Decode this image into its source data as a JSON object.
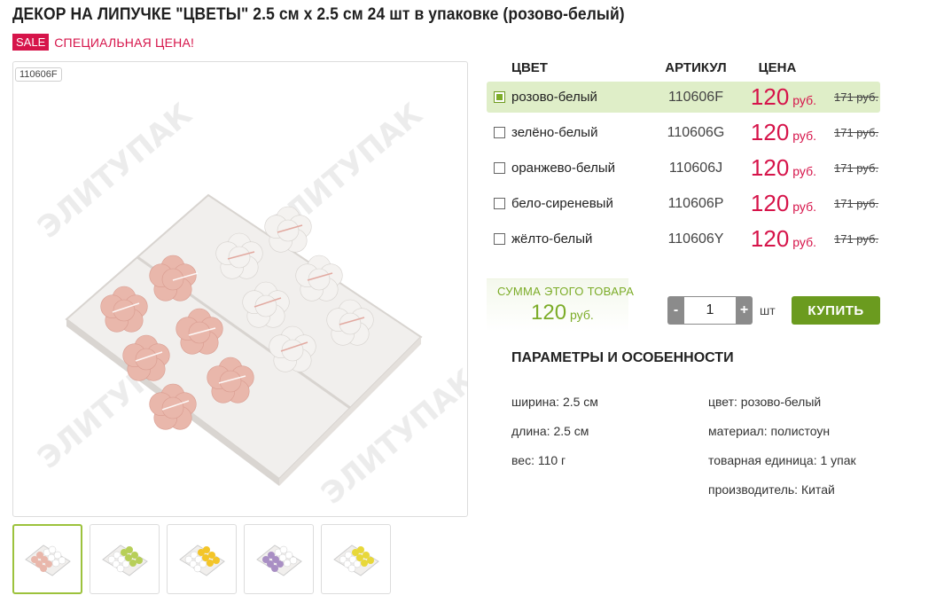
{
  "product": {
    "title": "ДЕКОР НА ЛИПУЧКЕ \"ЦВЕТЫ\" 2.5 см х 2.5 см 24 шт в упаковке (розово-белый)",
    "sale_badge": "SALE",
    "sale_text": "СПЕЦИАЛЬНАЯ ЦЕНА!",
    "image_sku_tag": "110606F",
    "watermark": "ЭЛИТУПАК"
  },
  "thumbnails": [
    {
      "name": "розово-белый",
      "colors": [
        "#e9b7ab",
        "#f2f0ee"
      ]
    },
    {
      "name": "зелёно-белый",
      "colors": [
        "#b7cf58",
        "#f2f0ee"
      ]
    },
    {
      "name": "оранжево-белый",
      "colors": [
        "#f3c528",
        "#f2f0ee"
      ]
    },
    {
      "name": "бело-сиреневый",
      "colors": [
        "#a98fc4",
        "#f2f0ee"
      ]
    },
    {
      "name": "жёлто-белый",
      "colors": [
        "#e8d83a",
        "#f2f0ee"
      ]
    }
  ],
  "variants_header": {
    "color": "ЦВЕТ",
    "sku": "АРТИКУЛ",
    "price": "ЦЕНА"
  },
  "variants": [
    {
      "name": "розово-белый",
      "sku": "110606F",
      "price": "120",
      "currency": "руб.",
      "old_price": "171 руб.",
      "selected": true
    },
    {
      "name": "зелёно-белый",
      "sku": "110606G",
      "price": "120",
      "currency": "руб.",
      "old_price": "171 руб.",
      "selected": false
    },
    {
      "name": "оранжево-белый",
      "sku": "110606J",
      "price": "120",
      "currency": "руб.",
      "old_price": "171 руб.",
      "selected": false
    },
    {
      "name": "бело-сиреневый",
      "sku": "110606P",
      "price": "120",
      "currency": "руб.",
      "old_price": "171 руб.",
      "selected": false
    },
    {
      "name": "жёлто-белый",
      "sku": "110606Y",
      "price": "120",
      "currency": "руб.",
      "old_price": "171 руб.",
      "selected": false
    }
  ],
  "summary": {
    "label": "СУММА ЭТОГО ТОВАРА",
    "value": "120",
    "currency": "руб."
  },
  "quantity": {
    "minus": "-",
    "value": "1",
    "plus": "+",
    "unit": "шт"
  },
  "buy_label": "КУПИТЬ",
  "params": {
    "title": "ПАРАМЕТРЫ И ОСОБЕННОСТИ",
    "left": [
      "ширина: 2.5 см",
      "длина: 2.5 см",
      "вес: 110 г"
    ],
    "right": [
      "цвет: розово-белый",
      "материал: полистоун",
      "товарная единица: 1 упак",
      "производитель: Китай"
    ]
  },
  "colors": {
    "accent_green": "#6b9b1f",
    "price_red": "#d6144a",
    "selected_row": "#dfeec8"
  }
}
